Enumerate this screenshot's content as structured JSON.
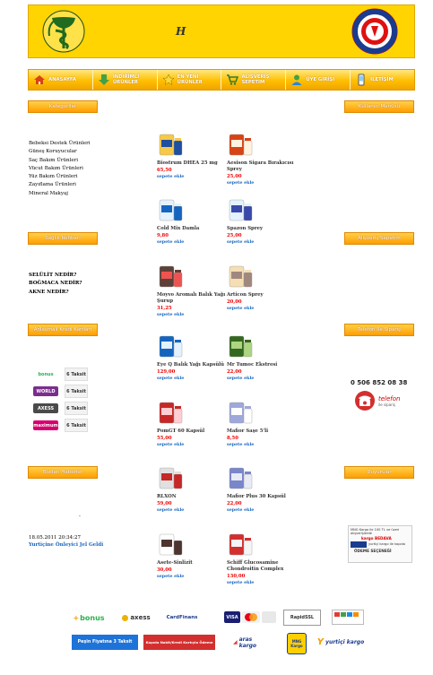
{
  "header": {
    "title": "H"
  },
  "nav": [
    {
      "label": "ANASAYFA",
      "icon": "home-icon"
    },
    {
      "label": "İNDİRİMLİ ÜRÜNLER",
      "icon": "down-arrow-icon"
    },
    {
      "label": "EN YENİ ÜRÜNLER",
      "icon": "star-icon"
    },
    {
      "label": "ALIŞVERİŞ SEPETİM",
      "icon": "cart-icon"
    },
    {
      "label": "ÜYE GİRİŞİ",
      "icon": "user-icon"
    },
    {
      "label": "İLETİŞİM",
      "icon": "phone-icon"
    }
  ],
  "left": {
    "categories_title": "Kategoriler",
    "categories": [
      "Bebeksi Destek Ürünleri",
      "Güneş Koruyucular",
      "Saç Bakım Ürünleri",
      "Vücut Bakım Ürünleri",
      "Yüz Bakım Ürünleri",
      "Zayıflama Ürünleri",
      "Mineral Makyaj"
    ],
    "health_title": "Sağlık Rehberi",
    "health": [
      "SELÜLİT NEDİR?",
      "BOĞMACA NEDİR?",
      "AKNE NEDİR?"
    ],
    "credit_title": "Anlaşmalı Kredi Kartları",
    "credit_cards": [
      {
        "name": "bonus",
        "color": "#2bb24c",
        "bg": "#ffffff",
        "taksit": "6 Taksit"
      },
      {
        "name": "WORLD",
        "color": "#ffffff",
        "bg": "#7b2d8e",
        "taksit": "6 Taksit"
      },
      {
        "name": "AXESS",
        "color": "#ffffff",
        "bg": "#4a4a4a",
        "taksit": "6 Taksit"
      },
      {
        "name": "maximum",
        "color": "#ffffff",
        "bg": "#d6006f",
        "taksit": "6 Taksit"
      }
    ],
    "news_title": "Bizden Haberler",
    "news_dash": "-",
    "news_date": "18.05.2011 20:34:27",
    "news_headline": "Yurtiçine Önleyici Jel Geldi"
  },
  "right": {
    "member_title": "Kullanıcı Menüsü",
    "cart_title": "Alışveriş Sepetim",
    "phone_title": "Telefon İle Sipariş",
    "phone_number": "0 506 852 08 38",
    "phone_word": "telefon",
    "phone_sub": "ile sipariş",
    "announce_title": "Duyurular",
    "announce_line1": "MNG Kargo ile 100 TL ve üzeri alışverişlerde",
    "announce_line2": "kargo BEDAVA",
    "announce_line3": "yurtiçi kargo ile kapıda",
    "announce_line4": "ÖDEME SEÇENEĞİ"
  },
  "products": [
    {
      "name": "Biostrum DHEA 25 mg",
      "price": "65,50",
      "cart": "sepete ekle"
    },
    {
      "name": "Aesison Sigara Bırakıcısı Sprey",
      "price": "25,00",
      "cart": "sepete ekle"
    },
    {
      "name": "Cold Mix Damla",
      "price": "9,80",
      "cart": "sepete ekle"
    },
    {
      "name": "Spazon Sprey",
      "price": "25,00",
      "cart": "sepete ekle"
    },
    {
      "name": "Moyvo Aromalı Balık Yağı Şurup",
      "price": "31,25",
      "cart": "sepete ekle"
    },
    {
      "name": "Articon Sprey",
      "price": "20,00",
      "cart": "sepete ekle"
    },
    {
      "name": "Eye Q Balık Yağı Kapsülü",
      "price": "129,00",
      "cart": "sepete ekle"
    },
    {
      "name": "Mr Tumoc Ekstresi",
      "price": "22,00",
      "cart": "sepete ekle"
    },
    {
      "name": "PomGT 60 Kapsül",
      "price": "55,00",
      "cart": "sepete ekle"
    },
    {
      "name": "Mafior Saşe 5'li",
      "price": "8,50",
      "cart": "sepete ekle"
    },
    {
      "name": "RLXON",
      "price": "59,00",
      "cart": "sepete ekle"
    },
    {
      "name": "Mafior Plus 30 Kapsül",
      "price": "22,00",
      "cart": "sepete ekle"
    },
    {
      "name": "Asete-Sinlizit",
      "price": "30,00",
      "cart": "sepete ekle"
    },
    {
      "name": "Schiff Glucosamine Chondroitin Complex",
      "price": "130,00",
      "cart": "sepete ekle"
    }
  ],
  "footer": {
    "row1": [
      "bonus",
      "axess",
      "CardFinans",
      "VISA",
      "MasterCard",
      "RapidSSL"
    ],
    "row2": [
      "Peşin Fiyatına 3 Taksit",
      "Kapıda Nakit/Kredi Kartıyla Ödeme",
      "aras kargo",
      "MNG Kargo",
      "yurtiçi kargo"
    ]
  },
  "colors": {
    "accent": "#ffbf00",
    "price": "#e00000",
    "link": "#1565c0"
  }
}
